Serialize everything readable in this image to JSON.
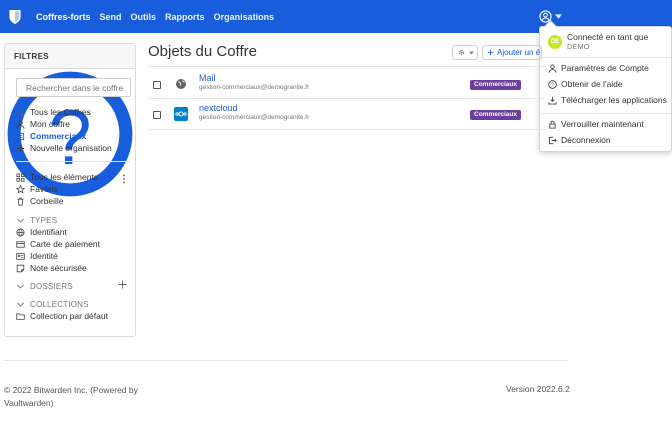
{
  "nav": {
    "links": [
      "Coffres-forts",
      "Send",
      "Outils",
      "Rapports",
      "Organisations"
    ]
  },
  "account_menu": {
    "avatar_initials": "DE",
    "logged_in_label": "Connecté en tant que",
    "user": "DEMO",
    "items": [
      "Paramètres de Compte",
      "Obtenir de l'aide",
      "Télécharger les applications"
    ],
    "lock": "Verrouiller maintenant",
    "logout": "Déconnexion"
  },
  "filters": {
    "title": "FILTRES",
    "search_placeholder": "Rechercher dans le coffre",
    "vaults": [
      "Tous les Coffres",
      "Mon coffre",
      "Commerciaux",
      "Nouvelle organisation"
    ],
    "items": [
      "Tous les éléments",
      "Favoris",
      "Corbeille"
    ],
    "types_title": "TYPES",
    "types": [
      "Identifiant",
      "Carte de paiement",
      "Identité",
      "Note sécurisée"
    ],
    "folders_title": "DOSSIERS",
    "collections_title": "COLLECTIONS",
    "collections": [
      "Collection par défaut"
    ]
  },
  "main": {
    "title": "Objets du Coffre",
    "add_label": "Ajouter un é",
    "rows": [
      {
        "name": "Mail",
        "sub": "gestion-commerciaux@demogranite.fr",
        "badge": "Commerciaux"
      },
      {
        "name": "nextcloud",
        "sub": "gestion-commerciaux@demogranite.fr",
        "badge": "Commerciaux"
      }
    ]
  },
  "footer": {
    "copyright": "© 2022 Bitwarden Inc. (Powered by Vaultwarden)",
    "version": "Version 2022.6.2"
  },
  "colors": {
    "navbar": "#175ddc",
    "badge": "#6b3fa0",
    "avatar": "#c8e52b"
  }
}
